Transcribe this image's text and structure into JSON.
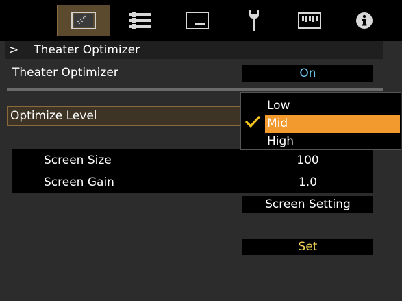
{
  "menu_tabs": [
    {
      "icon": "picture-icon",
      "active": true
    },
    {
      "icon": "settings-list-icon",
      "active": false
    },
    {
      "icon": "display-icon",
      "active": false
    },
    {
      "icon": "wrench-icon",
      "active": false
    },
    {
      "icon": "keyboard-icon",
      "active": false
    },
    {
      "icon": "info-icon",
      "active": false
    }
  ],
  "breadcrumb": {
    "arrow": ">",
    "title": "Theater Optimizer"
  },
  "rows": {
    "theater_optimizer": {
      "label": "Theater Optimizer",
      "value": "On"
    },
    "optimize_level": {
      "label": "Optimize Level"
    }
  },
  "screen_info": {
    "size_label": "Screen Size",
    "size_value": "100",
    "gain_label": "Screen Gain",
    "gain_value": "1.0"
  },
  "buttons": {
    "screen_setting": "Screen Setting",
    "set": "Set"
  },
  "dropdown": {
    "options": [
      "Low",
      "Mid",
      "High"
    ],
    "selected": "Mid"
  },
  "colors": {
    "accent": "#f39a2e",
    "active_tab": "#5b4a2d",
    "background": "#2c2c2c"
  }
}
